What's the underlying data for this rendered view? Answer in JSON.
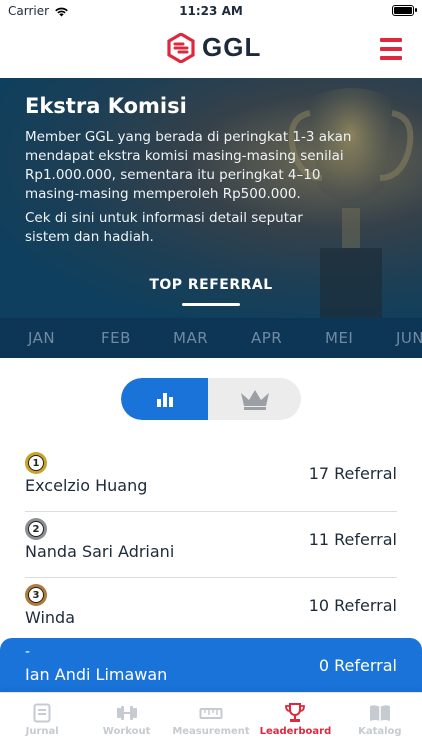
{
  "status": {
    "carrier": "Carrier",
    "time": "11:23 AM"
  },
  "header": {
    "brand": "GGL"
  },
  "hero": {
    "title": "Ekstra Komisi",
    "paragraph1": "Member GGL yang berada di peringkat 1-3 akan mendapat ekstra komisi masing-masing senilai Rp1.000.000, sementara itu peringkat 4–10 masing-masing memperoleh Rp500.000.",
    "paragraph2": "Cek di sini untuk informasi detail seputar sistem dan hadiah.",
    "tab": "TOP REFERRAL"
  },
  "months": [
    "JAN",
    "FEB",
    "MAR",
    "APR",
    "MEI",
    "JUN"
  ],
  "toggle": {
    "left_icon": "bar-chart-icon",
    "right_icon": "crown-icon",
    "active": "left"
  },
  "leaderboard": [
    {
      "rank": "1",
      "name": "Excelzio Huang",
      "count": "17 Referral",
      "medal_color": "#c9a227"
    },
    {
      "rank": "2",
      "name": "Nanda Sari Adriani",
      "count": "11 Referral",
      "medal_color": "#8a8f96"
    },
    {
      "rank": "3",
      "name": "Winda",
      "count": "10 Referral",
      "medal_color": "#b07a3c"
    }
  ],
  "me": {
    "rank": "-",
    "name": "Ian Andi Limawan",
    "count": "0 Referral"
  },
  "tabs": [
    {
      "label": "Jurnal",
      "icon": "journal-icon"
    },
    {
      "label": "Workout",
      "icon": "dumbbell-icon"
    },
    {
      "label": "Measurement",
      "icon": "ruler-icon"
    },
    {
      "label": "Leaderboard",
      "icon": "trophy-icon",
      "active": true
    },
    {
      "label": "Katalog",
      "icon": "book-icon"
    }
  ],
  "colors": {
    "accent": "#1a73d9",
    "brand_red": "#e0283c",
    "hero_dark": "#0d3656"
  }
}
